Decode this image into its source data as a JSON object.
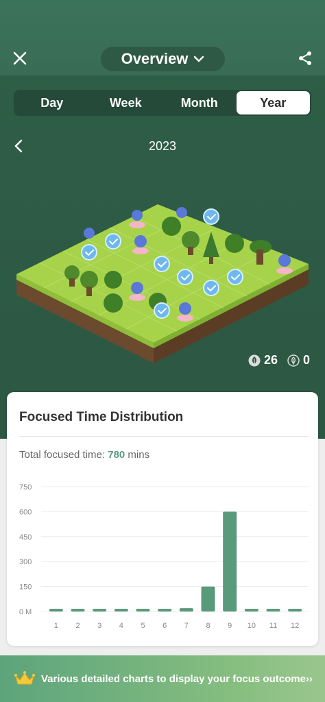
{
  "header": {
    "title": "Overview"
  },
  "tabs": [
    {
      "label": "Day",
      "active": false
    },
    {
      "label": "Week",
      "active": false
    },
    {
      "label": "Month",
      "active": false
    },
    {
      "label": "Year",
      "active": true
    }
  ],
  "period": {
    "label": "2023"
  },
  "forest": {
    "healthy_count": "26",
    "withered_count": "0"
  },
  "card": {
    "title": "Focused Time Distribution",
    "total_label": "Total focused time: ",
    "total_value": "780",
    "total_unit": " mins"
  },
  "chart_data": {
    "type": "bar",
    "categories": [
      "1",
      "2",
      "3",
      "4",
      "5",
      "6",
      "7",
      "8",
      "9",
      "10",
      "11",
      "12"
    ],
    "values": [
      0,
      0,
      0,
      0,
      0,
      0,
      20,
      150,
      600,
      0,
      0,
      0
    ],
    "yticks": [
      "0 M",
      "150",
      "300",
      "450",
      "600",
      "750"
    ],
    "ylim": [
      0,
      750
    ],
    "color": "#5a9a7c",
    "grid": true
  },
  "promo": {
    "text": "Various detailed charts to display your focus outcome",
    "arrow": "››"
  },
  "colors": {
    "accent": "#5a9a7c",
    "bar": "#5a9a7c"
  }
}
